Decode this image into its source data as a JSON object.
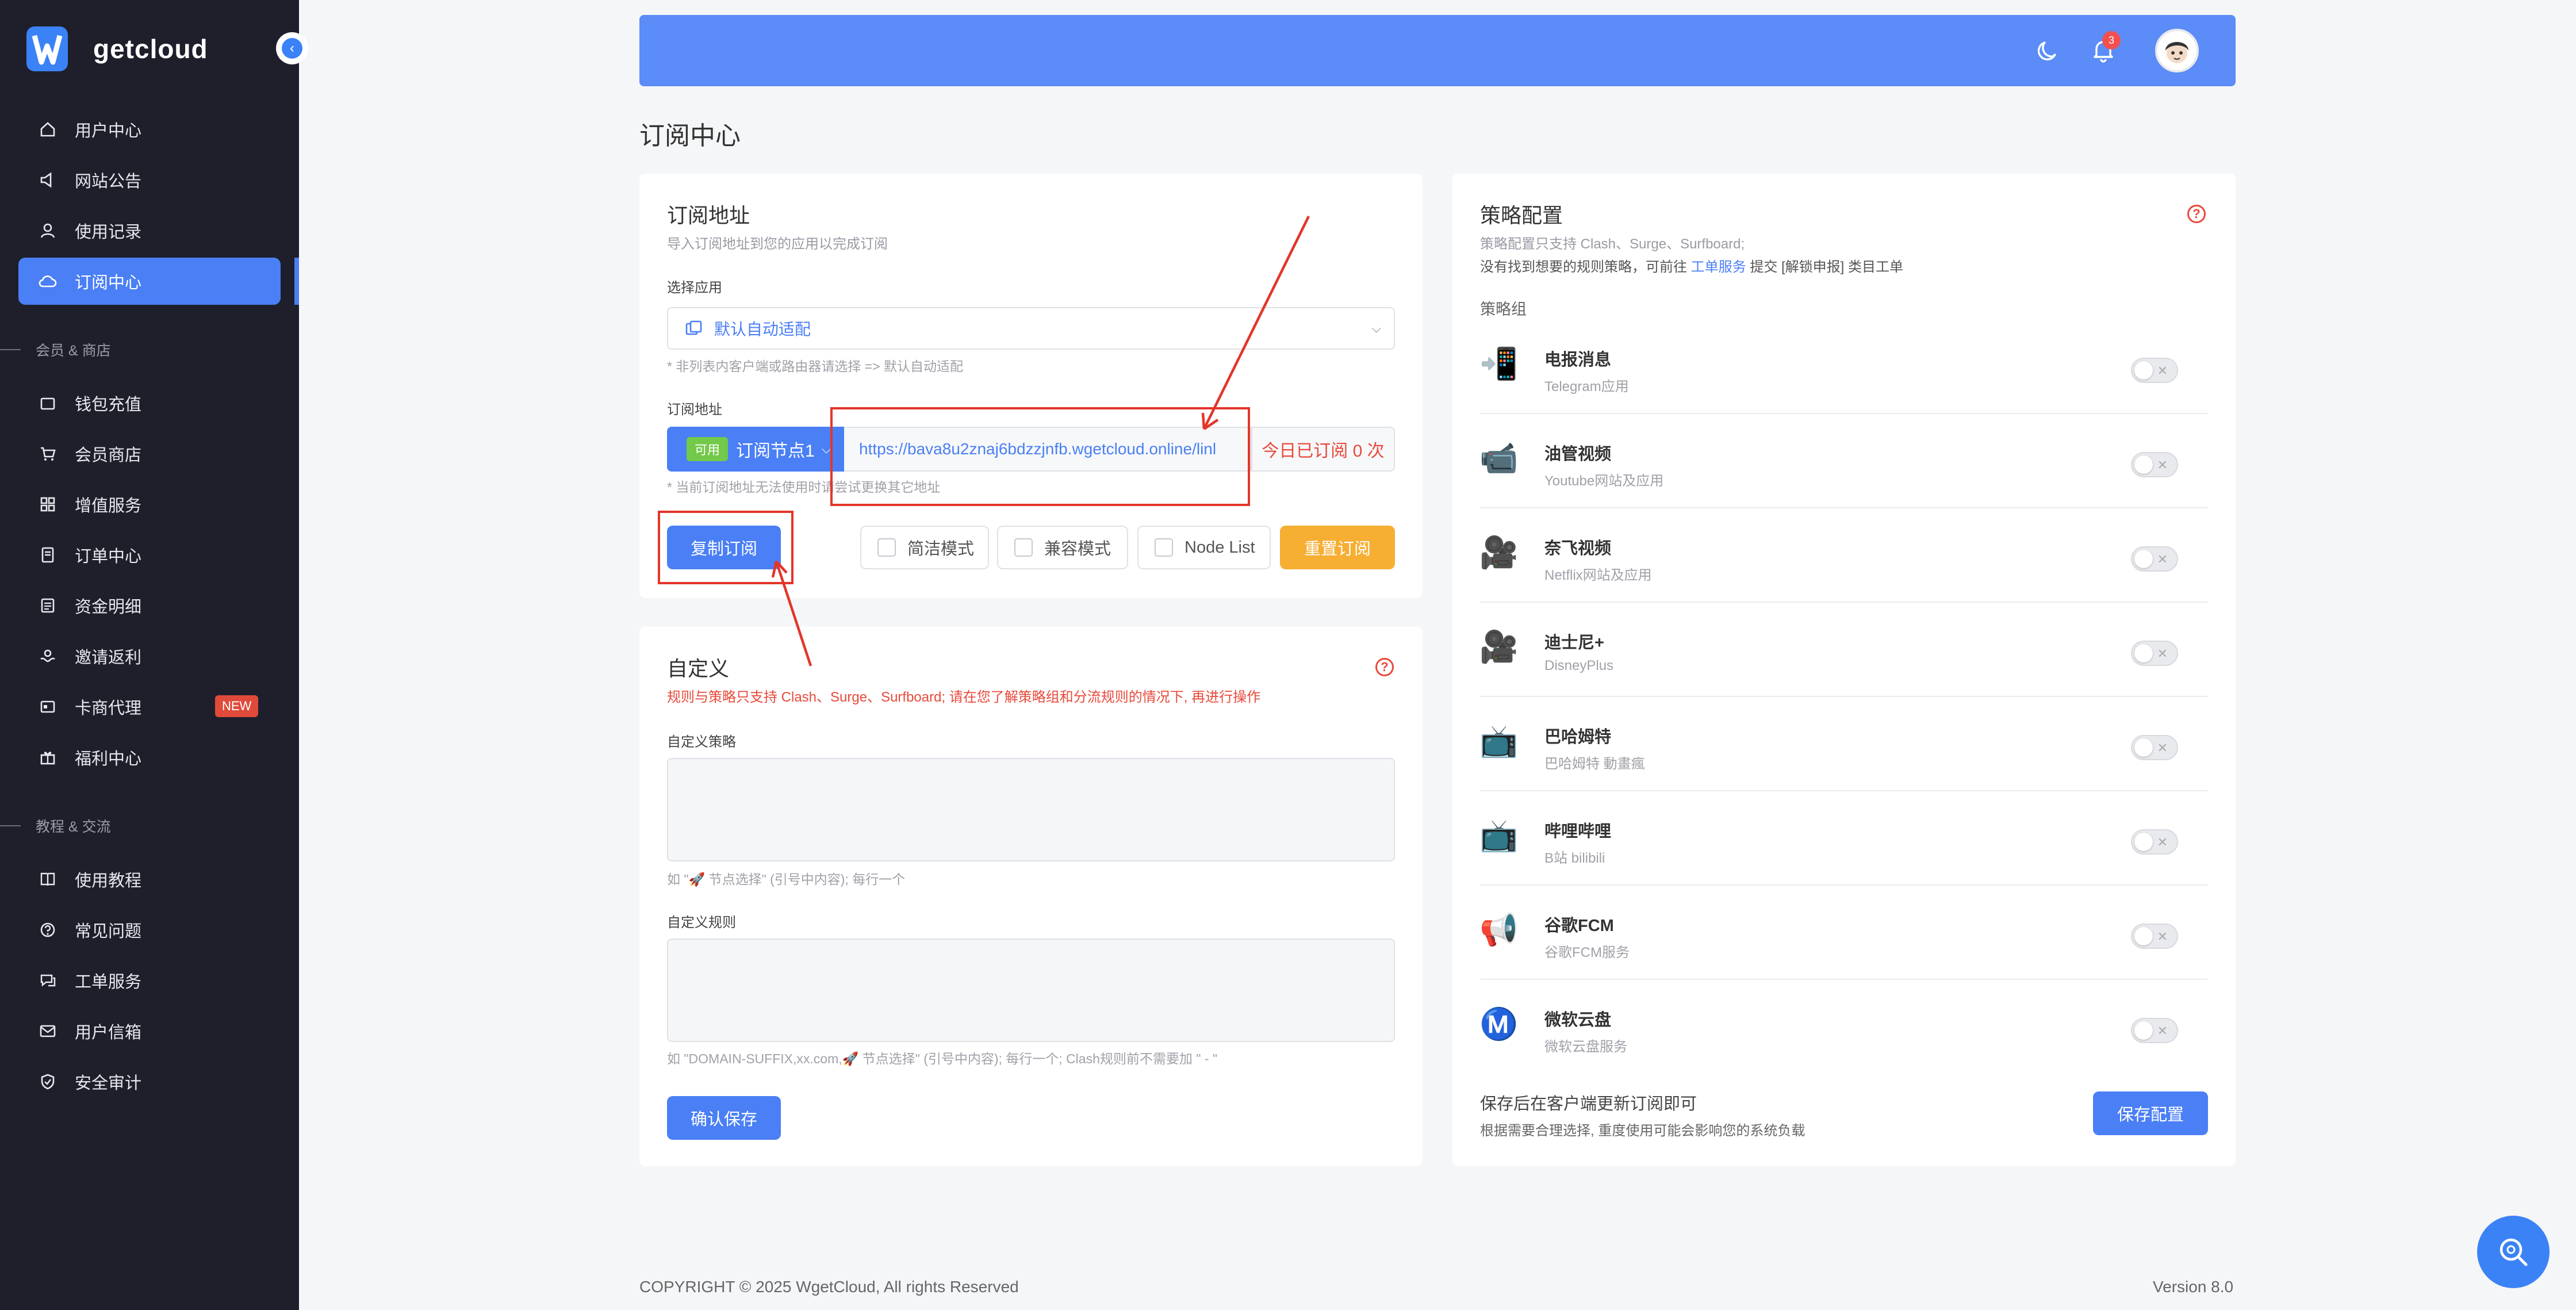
{
  "sidebar": {
    "logo_text": "getcloud",
    "items": [
      {
        "label": "用户中心",
        "icon": "home-icon"
      },
      {
        "label": "网站公告",
        "icon": "megaphone-icon"
      },
      {
        "label": "使用记录",
        "icon": "user-log-icon"
      },
      {
        "label": "订阅中心",
        "icon": "cloud-icon",
        "active": true
      }
    ],
    "section_shop": "会员 & 商店",
    "shop_items": [
      {
        "label": "钱包充值",
        "icon": "wallet-icon"
      },
      {
        "label": "会员商店",
        "icon": "cart-icon"
      },
      {
        "label": "增值服务",
        "icon": "apps-icon"
      },
      {
        "label": "订单中心",
        "icon": "order-icon"
      },
      {
        "label": "资金明细",
        "icon": "ledger-icon"
      },
      {
        "label": "邀请返利",
        "icon": "gift-hand-icon"
      },
      {
        "label": "卡商代理",
        "icon": "card-icon",
        "badge": "NEW"
      },
      {
        "label": "福利中心",
        "icon": "gift-icon"
      }
    ],
    "section_help": "教程 & 交流",
    "help_items": [
      {
        "label": "使用教程",
        "icon": "book-icon"
      },
      {
        "label": "常见问题",
        "icon": "question-icon"
      },
      {
        "label": "工单服务",
        "icon": "ticket-icon"
      },
      {
        "label": "用户信箱",
        "icon": "mail-icon"
      },
      {
        "label": "安全审计",
        "icon": "shield-icon"
      }
    ]
  },
  "header": {
    "notification_count": "3",
    "icons": [
      "moon-icon",
      "bell-icon",
      "avatar"
    ]
  },
  "page_title": "订阅中心",
  "subscription": {
    "title": "订阅地址",
    "subtitle": "导入订阅地址到您的应用以完成订阅",
    "app_label": "选择应用",
    "app_value": "默认自动适配",
    "app_hint": "* 非列表内客户端或路由器请选择 => 默认自动适配",
    "url_label": "订阅地址",
    "node_status": "可用",
    "node_name": "订阅节点1",
    "url": "https://bava8u2znaj6bdzzjnfb.wgetcloud.online/linl",
    "today_count": "今日已订阅 0 次",
    "url_hint": "* 当前订阅地址无法使用时请尝试更换其它地址",
    "copy_button": "复制订阅",
    "mode_simple": "简洁模式",
    "mode_compat": "兼容模式",
    "mode_nodelist": "Node List",
    "reset_button": "重置订阅"
  },
  "custom": {
    "title": "自定义",
    "warning": "规则与策略只支持 Clash、Surge、Surfboard; 请在您了解策略组和分流规则的情况下, 再进行操作",
    "policy_label": "自定义策略",
    "policy_hint": "如 \"🚀 节点选择\" (引号中内容); 每行一个",
    "rule_label": "自定义规则",
    "rule_hint": "如 \"DOMAIN-SUFFIX,xx.com,🚀 节点选择\" (引号中内容); 每行一个; Clash规则前不需要加 \" - \"",
    "save_button": "确认保存"
  },
  "strategy": {
    "title": "策略配置",
    "desc1": "策略配置只支持 Clash、Surge、Surfboard;",
    "desc2_pre": "没有找到想要的规则策略，可前往",
    "desc2_link": "工单服务",
    "desc2_post": "提交 [解锁申报] 类目工单",
    "group_label": "策略组",
    "items": [
      {
        "name": "电报消息",
        "desc": "Telegram应用",
        "icon": "📲"
      },
      {
        "name": "油管视频",
        "desc": "Youtube网站及应用",
        "icon": "📹"
      },
      {
        "name": "奈飞视频",
        "desc": "Netflix网站及应用",
        "icon": "🎥"
      },
      {
        "name": "迪士尼+",
        "desc": "DisneyPlus",
        "icon": "🎥"
      },
      {
        "name": "巴哈姆特",
        "desc": "巴哈姆特 動畫瘋",
        "icon": "📺"
      },
      {
        "name": "哔哩哔哩",
        "desc": "B站 bilibili",
        "icon": "📺"
      },
      {
        "name": "谷歌FCM",
        "desc": "谷歌FCM服务",
        "icon": "📢"
      },
      {
        "name": "微软云盘",
        "desc": "微软云盘服务",
        "icon": "Ⓜ️"
      }
    ],
    "footer_title": "保存后在客户端更新订阅即可",
    "footer_desc": "根据需要合理选择, 重度使用可能会影响您的系统负载",
    "save_button": "保存配置"
  },
  "footer": {
    "copyright": "COPYRIGHT © 2025 WgetCloud, All rights Reserved",
    "version": "Version 8.0"
  }
}
